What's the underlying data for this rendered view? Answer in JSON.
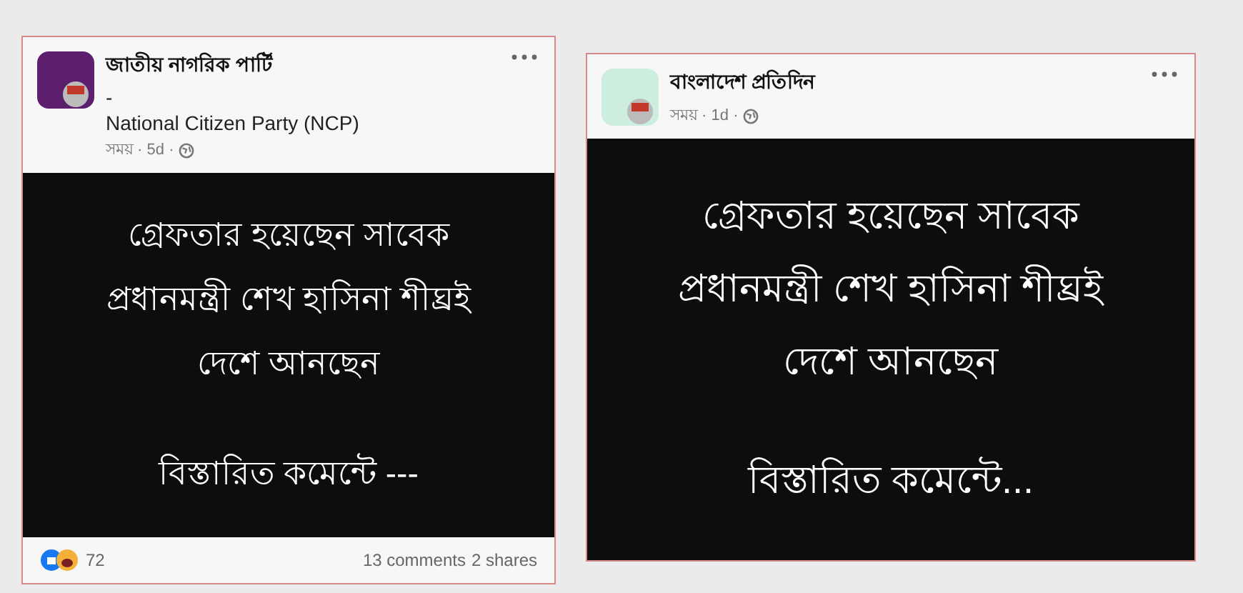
{
  "posts": [
    {
      "page_name": "জাতীয় নাগরিক পার্টি",
      "subtitle_lines": [
        "-",
        "National Citizen Party (NCP)"
      ],
      "meta": "সময় · 5d ·",
      "body_lines": [
        "গ্রেফতার হয়েছেন সাবেক",
        "প্রধানমন্ত্রী শেখ হাসিনা শীঘ্রই",
        "দেশে আনছেন"
      ],
      "closing": "বিস্তারিত কমেন্টে ---",
      "footer": {
        "reactions": "72",
        "comments": "13 comments",
        "shares": "2 shares"
      }
    },
    {
      "page_name": "বাংলাদেশ প্রতিদিন",
      "meta": "সময় · 1d ·",
      "body_lines": [
        "গ্রেফতার হয়েছেন সাবেক",
        "প্রধানমন্ত্রী শেখ হাসিনা শীঘ্রই",
        "দেশে আনছেন"
      ],
      "closing": "বিস্তারিত কমেন্টে..."
    }
  ]
}
